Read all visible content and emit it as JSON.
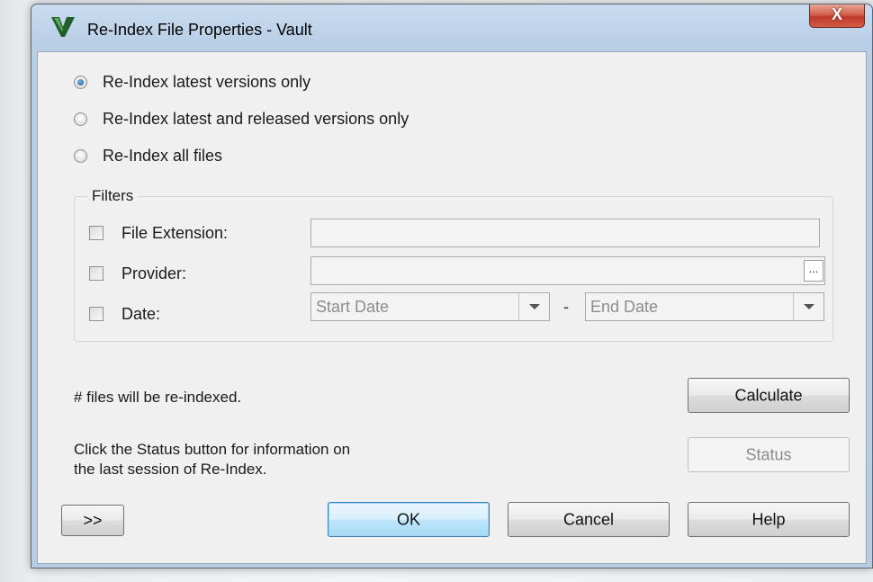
{
  "window": {
    "title": "Re-Index File Properties - Vault",
    "close_glyph": "X",
    "colors": {
      "close_button": "#c0392b",
      "frame": "#b9cfe6",
      "client": "#f0f0f0"
    }
  },
  "options": {
    "radios": [
      {
        "label": "Re-Index latest versions only",
        "checked": true
      },
      {
        "label": "Re-Index latest and released versions only",
        "checked": false
      },
      {
        "label": "Re-Index all files",
        "checked": false
      }
    ]
  },
  "filters": {
    "legend": "Filters",
    "file_extension": {
      "label": "File Extension:",
      "checked": false,
      "value": ""
    },
    "provider": {
      "label": "Provider:",
      "checked": false,
      "value": "",
      "browse_glyph": "..."
    },
    "date": {
      "label": "Date:",
      "checked": false,
      "start_placeholder": "Start Date",
      "separator": "-",
      "end_placeholder": "End Date"
    }
  },
  "calc": {
    "message": "# files will be re-indexed.",
    "button": "Calculate"
  },
  "status": {
    "line1": "Click the Status button for information on",
    "line2": "the last session of Re-Index.",
    "button": "Status"
  },
  "footer": {
    "expand": ">>",
    "ok": "OK",
    "cancel": "Cancel",
    "help": "Help"
  }
}
